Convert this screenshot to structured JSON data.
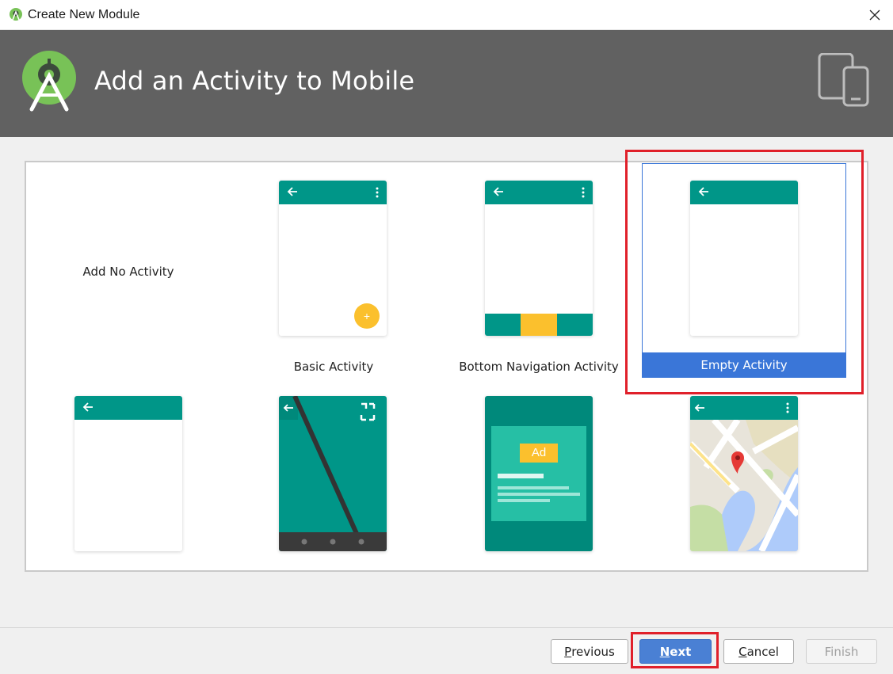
{
  "window": {
    "title": "Create New Module"
  },
  "header": {
    "heading": "Add an Activity to Mobile"
  },
  "templates": [
    {
      "label": "Add No Activity"
    },
    {
      "label": "Basic Activity"
    },
    {
      "label": "Bottom Navigation Activity"
    },
    {
      "label": "Empty Activity",
      "selected": true
    },
    {
      "label": ""
    },
    {
      "label": ""
    },
    {
      "label": ""
    },
    {
      "label": ""
    }
  ],
  "ad_badge": "Ad",
  "fab_symbol": "+",
  "buttons": {
    "previous": {
      "mnemonic": "P",
      "rest": "revious"
    },
    "next": {
      "mnemonic": "N",
      "rest": "ext"
    },
    "cancel": {
      "mnemonic": "C",
      "rest": "ancel"
    },
    "finish": {
      "label": "Finish"
    }
  },
  "colors": {
    "header": "#616161",
    "toolbar": "#009688",
    "selection": "#3a76d8",
    "highlight": "#e0202a",
    "fab": "#fbc02d"
  }
}
